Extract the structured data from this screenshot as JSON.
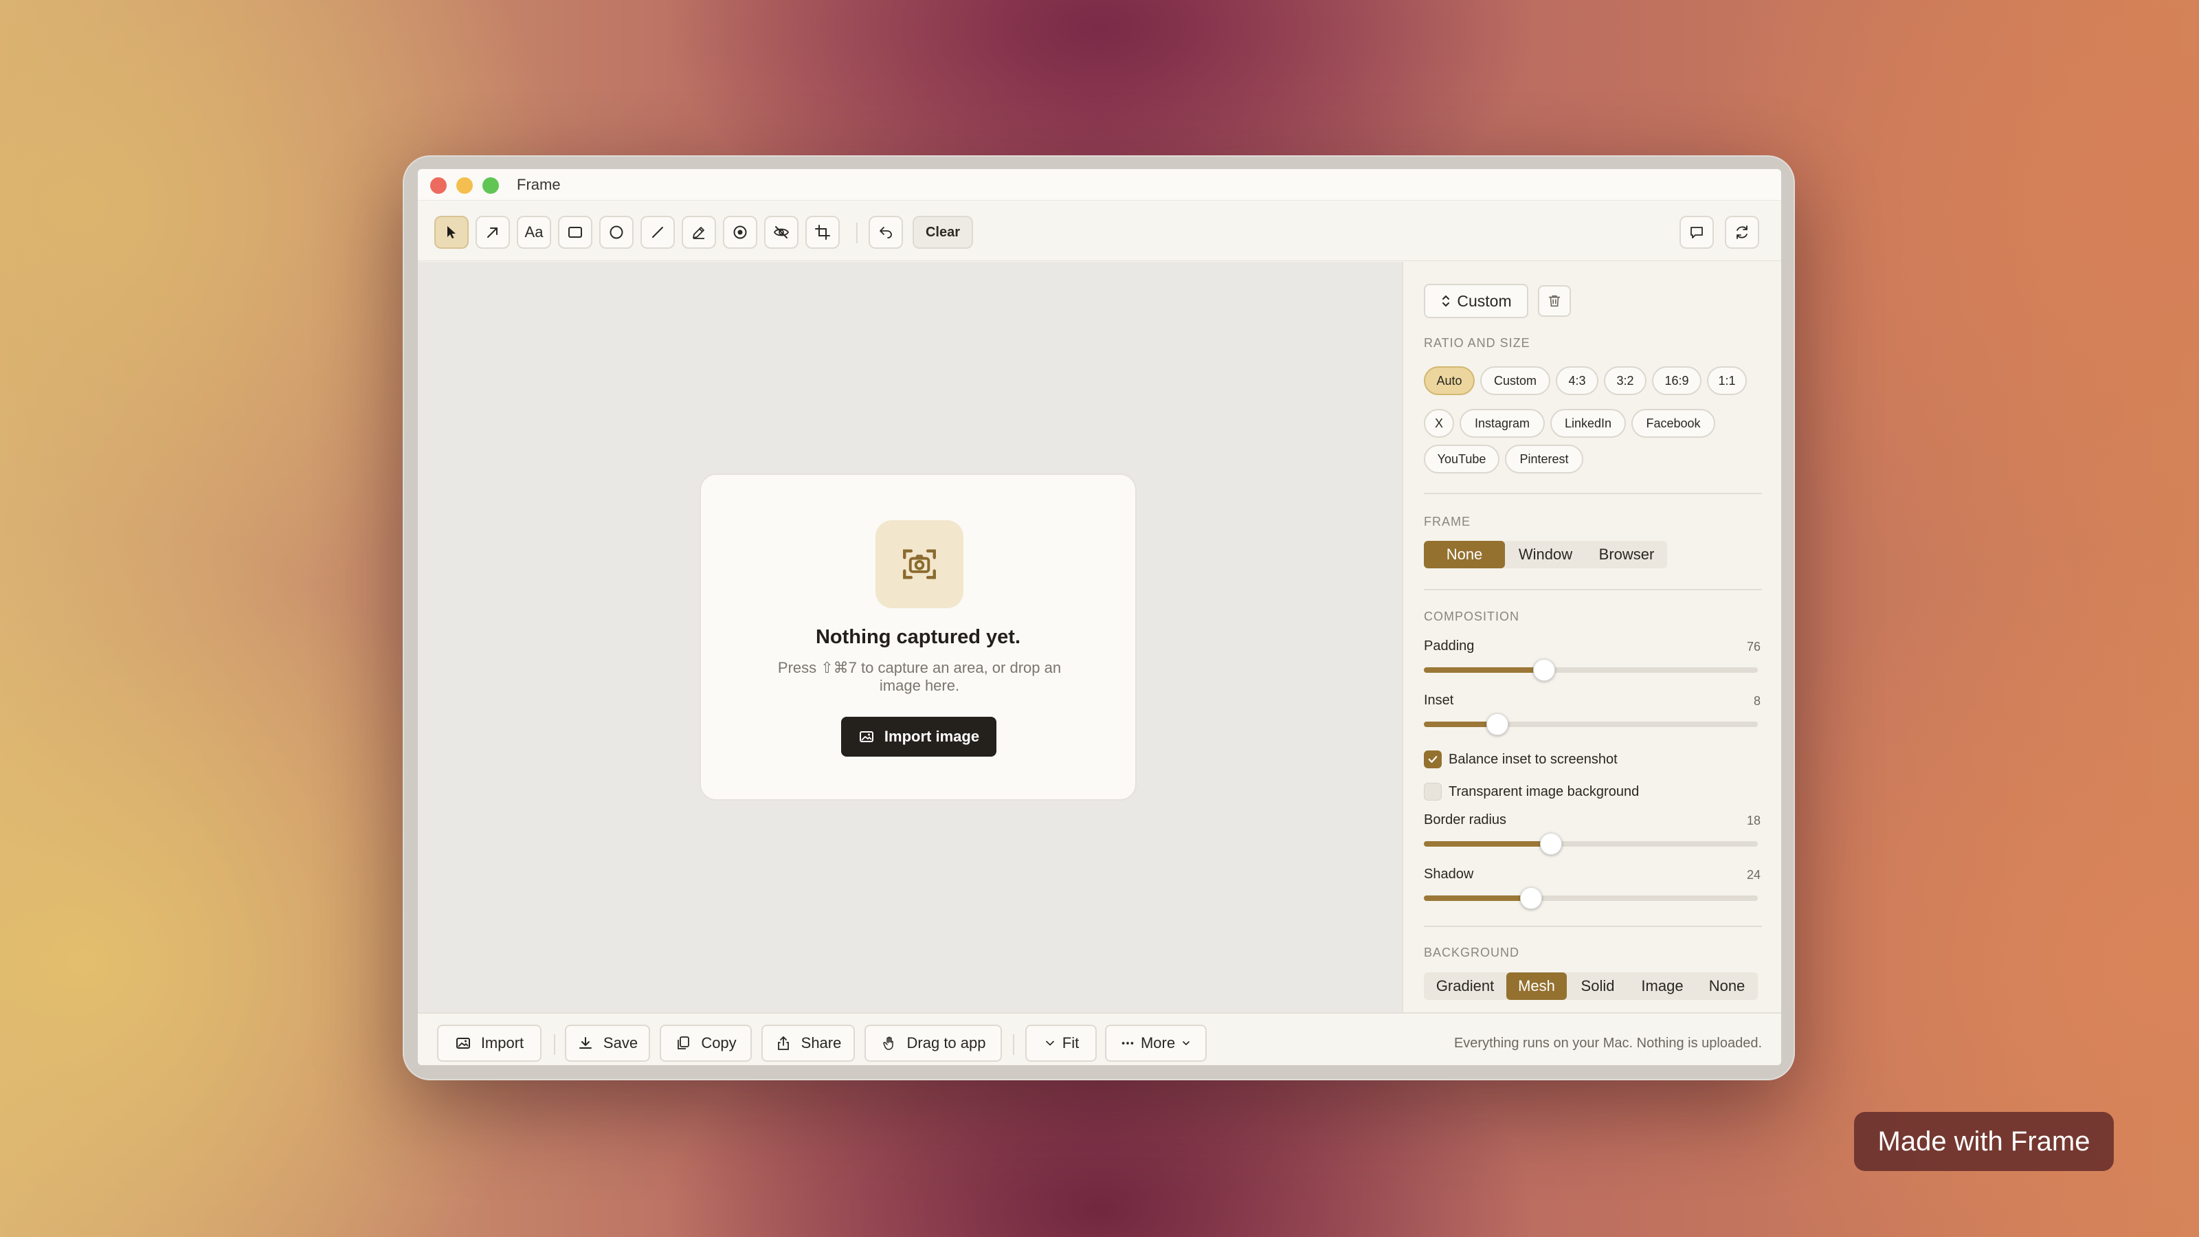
{
  "window": {
    "title": "Frame"
  },
  "toolbar": {
    "tools": [
      {
        "name": "select-tool",
        "icon": "cursor-icon"
      },
      {
        "name": "arrow-tool",
        "icon": "arrow-icon"
      },
      {
        "name": "text-tool",
        "icon": "text-icon",
        "label": "Aa"
      },
      {
        "name": "rectangle-tool",
        "icon": "rectangle-icon"
      },
      {
        "name": "ellipse-tool",
        "icon": "circle-icon"
      },
      {
        "name": "line-tool",
        "icon": "line-icon"
      },
      {
        "name": "pen-tool",
        "icon": "pen-icon"
      },
      {
        "name": "counter-tool",
        "icon": "target-icon"
      },
      {
        "name": "redact-tool",
        "icon": "eye-off-icon"
      },
      {
        "name": "crop-tool",
        "icon": "crop-icon"
      }
    ],
    "clear_label": "Clear"
  },
  "empty_state": {
    "title": "Nothing captured yet.",
    "subtitle": "Press ⇧⌘7 to capture an area, or drop an image here.",
    "button_label": "Import image"
  },
  "panel": {
    "preset_label": "Custom",
    "ratio_section": "RATIO AND SIZE",
    "ratio_chips": [
      "Auto",
      "Custom",
      "4:3",
      "3:2",
      "16:9",
      "1:1"
    ],
    "social_chips_row1": [
      "X",
      "Instagram",
      "LinkedIn",
      "Facebook"
    ],
    "social_chips_row2": [
      "YouTube",
      "Pinterest"
    ],
    "active_ratio": "Auto",
    "frame_section": "FRAME",
    "frame_options": [
      "None",
      "Window",
      "Browser"
    ],
    "active_frame": "None",
    "composition_section": "COMPOSITION",
    "sliders": [
      {
        "label": "Padding",
        "value": "76"
      },
      {
        "label": "Inset",
        "value": "8"
      },
      {
        "label": "Border radius",
        "value": "18"
      },
      {
        "label": "Shadow",
        "value": "24"
      }
    ],
    "slider_levels": [
      0.36,
      0.22,
      0.38,
      0.32
    ],
    "checkboxes": [
      {
        "label": "Balance inset to screenshot",
        "checked": true
      },
      {
        "label": "Transparent image background",
        "checked": false
      }
    ],
    "background_section": "BACKGROUND",
    "background_options": [
      "Gradient",
      "Mesh",
      "Solid",
      "Image",
      "None"
    ],
    "active_background": "Mesh"
  },
  "bottombar": {
    "import_label": "Import",
    "save_label": "Save",
    "copy_label": "Copy",
    "share_label": "Share",
    "drag_label": "Drag to app",
    "fit_label": "Fit",
    "more_label": "More",
    "privacy_text": "Everything runs on your Mac. Nothing is uploaded."
  },
  "watermark": "Made with Frame",
  "colors": {
    "accent": "#94712f",
    "chip_active": "#ecd69e",
    "dark_button": "#24211d"
  }
}
